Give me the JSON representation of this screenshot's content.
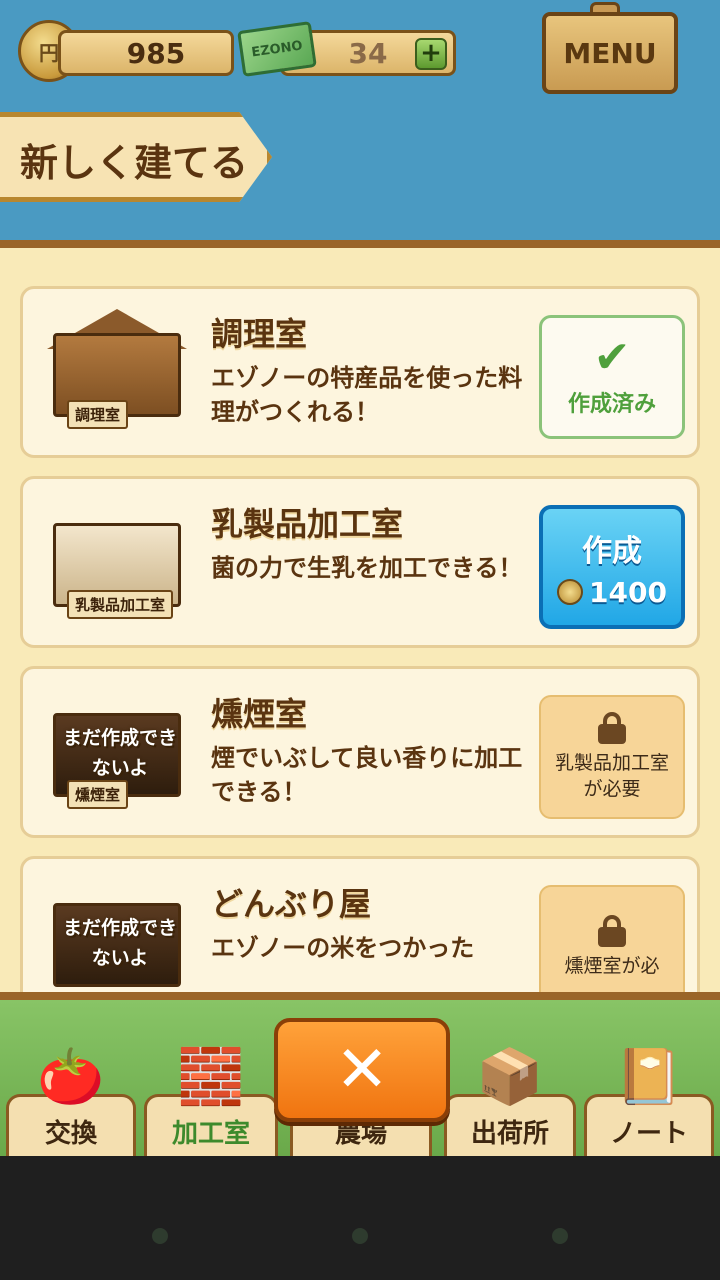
{
  "hud": {
    "coins": "985",
    "coin_icon_label": "円",
    "tickets": "34",
    "ticket_icon_label": "EZONO",
    "plus": "+",
    "menu": "MENU"
  },
  "title": "新しく建てる",
  "cards": [
    {
      "name": "調理室",
      "desc": "エゾノーの特産品を使った料理がつくれる！",
      "illus_tag": "調理室",
      "status": "done",
      "status_label": "作成済み",
      "check_icon": "check-icon"
    },
    {
      "name": "乳製品加工室",
      "desc": "菌の力で生乳を加工できる！",
      "illus_tag": "乳製品加工室",
      "status": "buy",
      "status_label": "作成",
      "price": "1400"
    },
    {
      "name": "燻煙室",
      "desc": "煙でいぶして良い香りに加工できる！",
      "illus_tag": "燻煙室",
      "locked_text": "まだ作成できないよ",
      "status": "locked",
      "status_label": "乳製品加工室が必要"
    },
    {
      "name": "どんぶり屋",
      "desc": "エゾノーの米をつかった",
      "locked_text": "まだ作成できないよ",
      "status": "locked",
      "status_label": "燻煙室が必"
    }
  ],
  "nav": [
    {
      "label": "交換",
      "icon": "vegetables-icon"
    },
    {
      "label": "加工室",
      "icon": "oven-icon",
      "active": true
    },
    {
      "label": "農場",
      "icon": "farm-icon"
    },
    {
      "label": "出荷所",
      "icon": "box-icon"
    },
    {
      "label": "ノート",
      "icon": "notebook-icon"
    }
  ],
  "close_label": "✕"
}
